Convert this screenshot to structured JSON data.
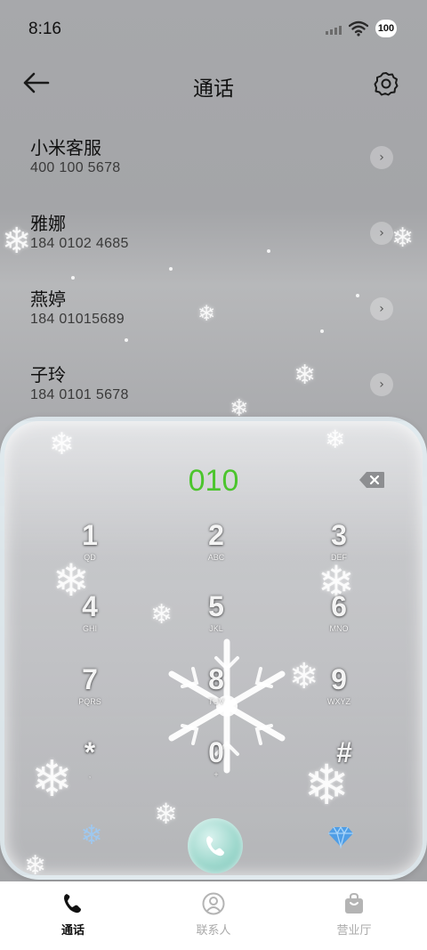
{
  "status_bar": {
    "time": "8:16",
    "battery": "100"
  },
  "header": {
    "title": "通话",
    "back_icon": "arrow-left-icon",
    "settings_icon": "gear-icon"
  },
  "contacts": [
    {
      "name": "小米客服",
      "number": "400 100 5678"
    },
    {
      "name": "雅娜",
      "number": "184 0102 4685"
    },
    {
      "name": "燕婷",
      "number": "184 01015689"
    },
    {
      "name": "子玲",
      "number": "184 0101 5678"
    }
  ],
  "dialpad": {
    "input": "010",
    "input_color": "#4cc52d",
    "keys": [
      {
        "digit": "1",
        "letters": "QD"
      },
      {
        "digit": "2",
        "letters": "ABC"
      },
      {
        "digit": "3",
        "letters": "DEF"
      },
      {
        "digit": "4",
        "letters": "GHI"
      },
      {
        "digit": "5",
        "letters": "JKL"
      },
      {
        "digit": "6",
        "letters": "MNO"
      },
      {
        "digit": "7",
        "letters": "PQRS"
      },
      {
        "digit": "8",
        "letters": "TUV"
      },
      {
        "digit": "9",
        "letters": "WXYZ"
      },
      {
        "digit": "*",
        "letters": ","
      },
      {
        "digit": "0",
        "letters": "+"
      },
      {
        "digit": "#",
        "letters": ""
      }
    ],
    "left_icon": "snowflake-icon",
    "call_icon": "phone-icon",
    "right_icon": "diamond-icon"
  },
  "bottom_nav": {
    "items": [
      {
        "label": "通话",
        "icon": "phone-icon",
        "active": true
      },
      {
        "label": "联系人",
        "icon": "person-icon",
        "active": false
      },
      {
        "label": "营业厅",
        "icon": "shopping-bag-icon",
        "active": false
      }
    ]
  }
}
